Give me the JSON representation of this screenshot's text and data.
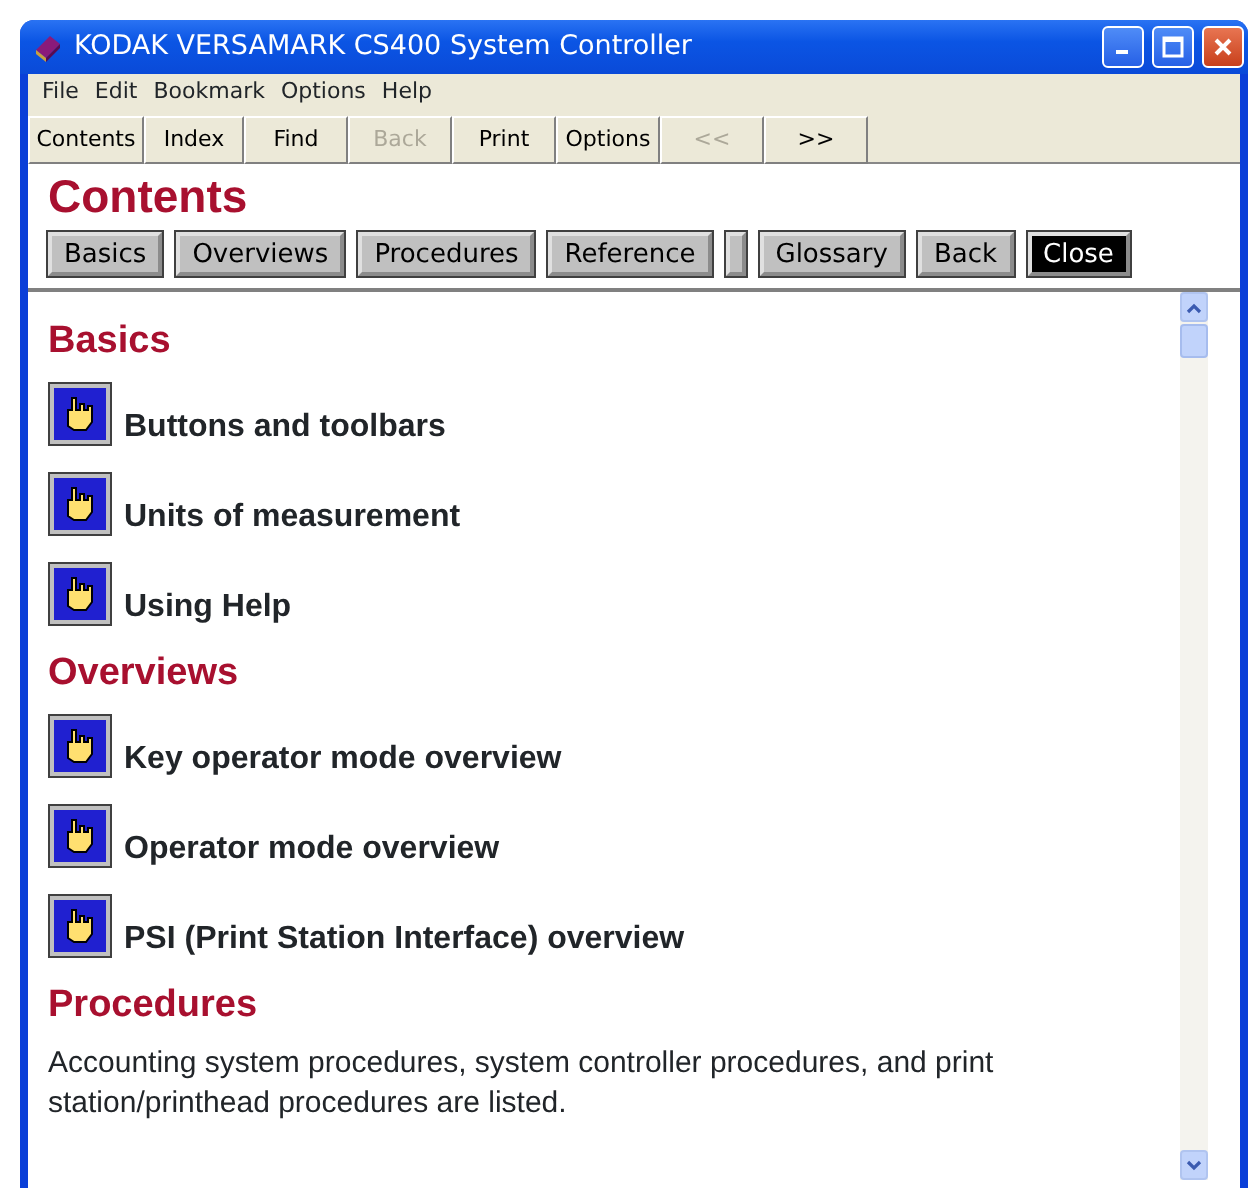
{
  "window": {
    "title": "KODAK VERSAMARK CS400 System Controller"
  },
  "menu": [
    "File",
    "Edit",
    "Bookmark",
    "Options",
    "Help"
  ],
  "toolbar": [
    {
      "label": "Contents",
      "disabled": false
    },
    {
      "label": "Index",
      "disabled": false
    },
    {
      "label": "Find",
      "disabled": false
    },
    {
      "label": "Back",
      "disabled": true
    },
    {
      "label": "Print",
      "disabled": false
    },
    {
      "label": "Options",
      "disabled": false
    },
    {
      "label": "<<",
      "disabled": true
    },
    {
      "label": ">>",
      "disabled": false
    }
  ],
  "page_title": "Contents",
  "nav_buttons": [
    {
      "kind": "button",
      "label": "Basics",
      "selected": false
    },
    {
      "kind": "button",
      "label": "Overviews",
      "selected": false
    },
    {
      "kind": "button",
      "label": "Procedures",
      "selected": false
    },
    {
      "kind": "button",
      "label": "Reference",
      "selected": false
    },
    {
      "kind": "blank"
    },
    {
      "kind": "button",
      "label": "Glossary",
      "selected": false
    },
    {
      "kind": "button",
      "label": "Back",
      "selected": false
    },
    {
      "kind": "button",
      "label": "Close",
      "selected": true
    }
  ],
  "sections": [
    {
      "heading": "Basics",
      "items": [
        "Buttons and toolbars",
        "Units of measurement",
        "Using Help"
      ]
    },
    {
      "heading": "Overviews",
      "items": [
        "Key operator mode overview",
        "Operator mode overview",
        "PSI (Print Station Interface) overview"
      ]
    },
    {
      "heading": "Procedures",
      "text": "Accounting system procedures, system controller procedures, and print station/printhead procedures are listed."
    }
  ]
}
